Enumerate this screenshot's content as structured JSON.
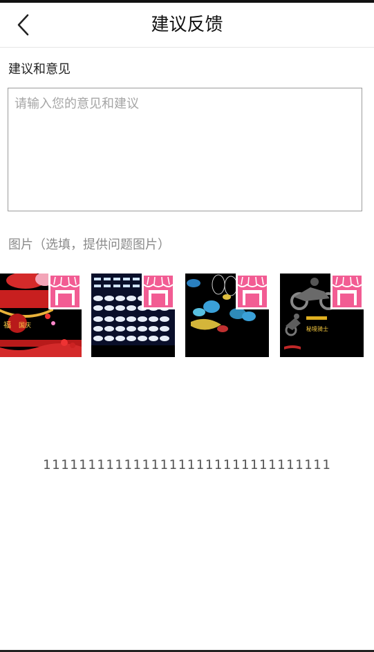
{
  "header": {
    "title": "建议反馈",
    "back_icon": "chevron-left-icon"
  },
  "feedback": {
    "label": "建议和意见",
    "placeholder": "请输入您的意见和建议",
    "value": ""
  },
  "images": {
    "label": "图片（选填，提供问题图片）",
    "items": [
      {
        "badge_icon": "store-icon",
        "badge_color": "#f25c93"
      },
      {
        "badge_icon": "store-icon",
        "badge_color": "#f25c93"
      },
      {
        "badge_icon": "store-icon",
        "badge_color": "#f25c93"
      },
      {
        "badge_icon": "store-icon",
        "badge_color": "#f25c93"
      }
    ]
  },
  "footer": {
    "text": "11111111111111111111111111111111"
  }
}
